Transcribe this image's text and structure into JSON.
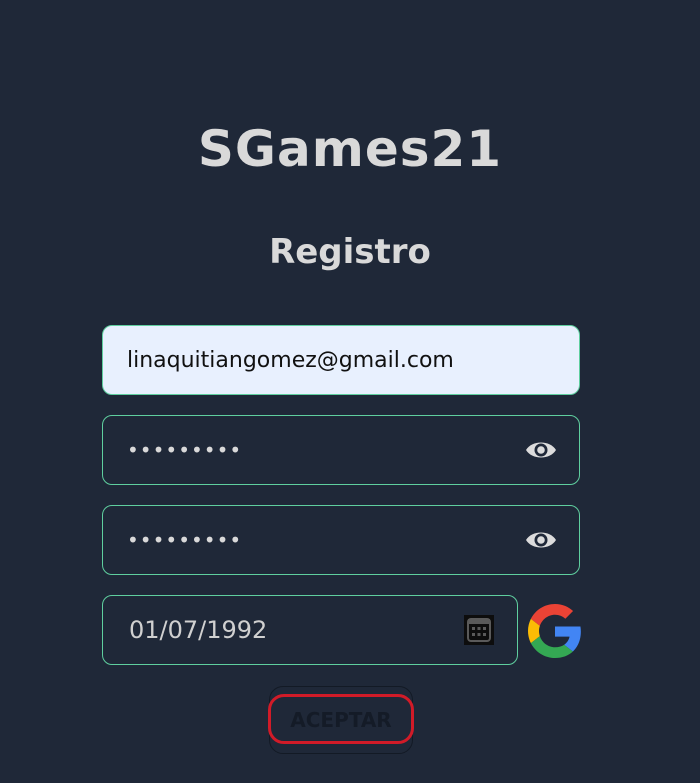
{
  "app": {
    "title": "SGames21"
  },
  "form": {
    "heading": "Registro",
    "email": {
      "value": "linaquitiangomez@gmail.com"
    },
    "password": {
      "value": "•••••••••",
      "toggle_icon": "eye-icon"
    },
    "confirm_password": {
      "value": "•••••••••",
      "toggle_icon": "eye-icon"
    },
    "birthdate": {
      "value": "01/07/1992",
      "picker_icon": "calendar-icon"
    },
    "google_icon": "google-icon",
    "submit_label": "ACEPTAR"
  },
  "colors": {
    "background": "#1f2838",
    "field_border": "#5fcf9f",
    "autofill_background": "#e8f0fe",
    "text_light": "#d9d9d9",
    "highlight_ring": "#d11b28"
  }
}
